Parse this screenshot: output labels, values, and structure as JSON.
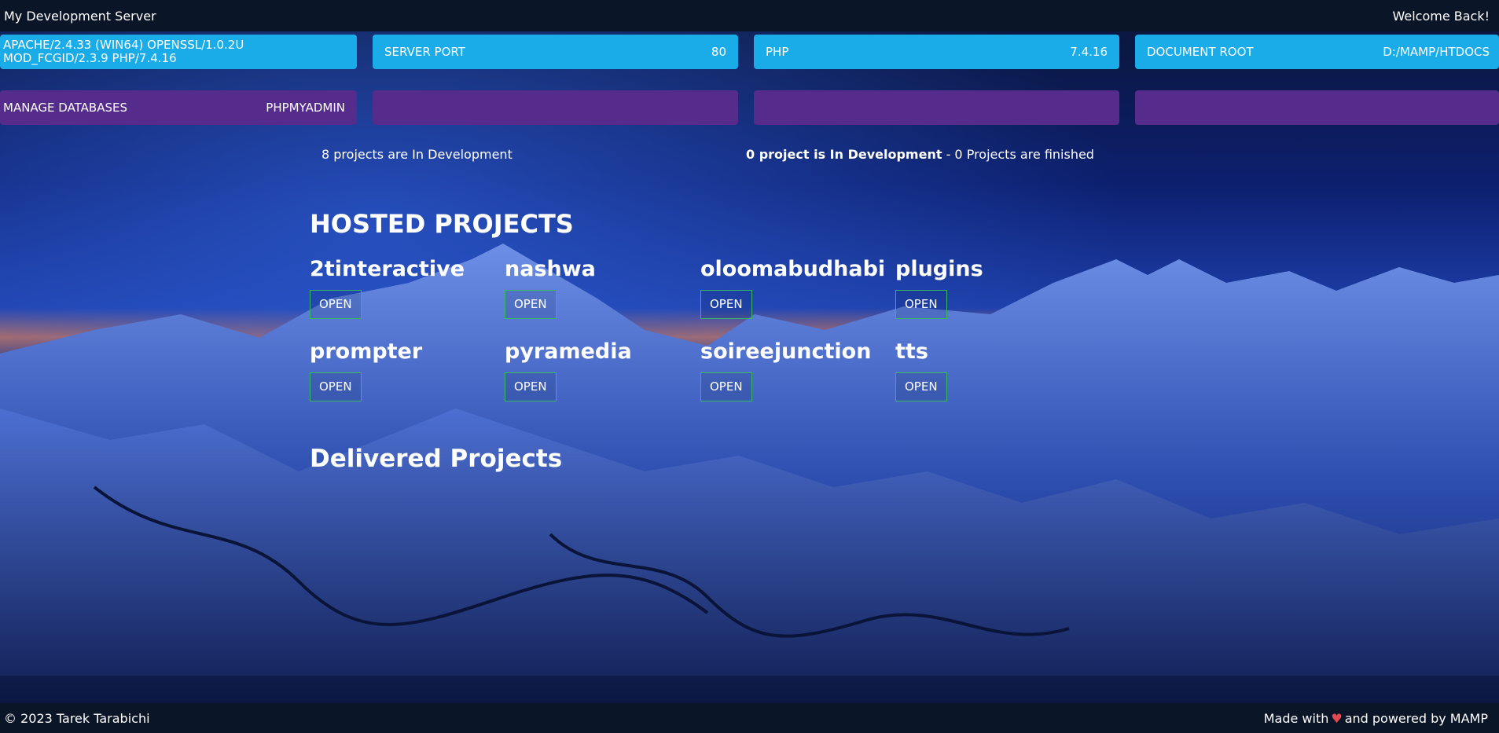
{
  "header": {
    "title": "My Development Server",
    "welcome": "Welcome Back!"
  },
  "info_cards": [
    {
      "label": "APACHE/2.4.33 (WIN64) OPENSSL/1.0.2U MOD_FCGID/2.3.9 PHP/7.4.16",
      "value": ""
    },
    {
      "label": "SERVER PORT",
      "value": "80"
    },
    {
      "label": "PHP",
      "value": "7.4.16"
    },
    {
      "label": "DOCUMENT ROOT",
      "value": "D:/MAMP/HTDOCS"
    }
  ],
  "tool_cards": [
    {
      "label": "MANAGE DATABASES",
      "value": "PHPMYADMIN"
    },
    {
      "label": "",
      "value": ""
    },
    {
      "label": "",
      "value": ""
    },
    {
      "label": "",
      "value": ""
    }
  ],
  "status": {
    "left": "8 projects are In Development",
    "right_bold": "0 project is In Development",
    "right_rest": " - 0 Projects are finished"
  },
  "hosted": {
    "title": "HOSTED PROJECTS",
    "open_label": "OPEN",
    "projects": [
      "2tinteractive",
      "nashwa",
      "oloomabudhabi",
      "plugins",
      "prompter",
      "pyramedia",
      "soireejunction",
      "tts"
    ]
  },
  "delivered": {
    "title": "Delivered Projects"
  },
  "footer": {
    "copyright": "© 2023 Tarek Tarabichi",
    "made_with": "Made with",
    "powered": "and powered by MAMP"
  },
  "colors": {
    "info_card": "#1aabe9",
    "tool_card": "#552b8c",
    "open_border": "#38b860",
    "heart": "#e4484f",
    "bars": "#0b1528"
  }
}
